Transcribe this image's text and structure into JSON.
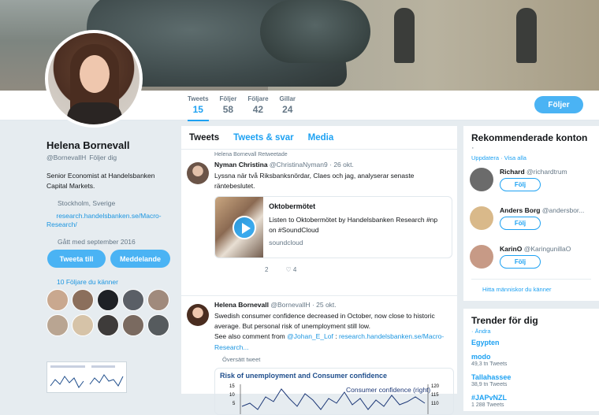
{
  "profile": {
    "name": "Helena Bornevall",
    "handle": "@BornevallH",
    "follows_you": "Följer dig",
    "bio": "Senior Economist at Handelsbanken Capital Markets.",
    "location": "Stockholm, Sverige",
    "url": "research.handelsbanken.se/Macro-Research/",
    "joined": "Gått med september 2016",
    "tweet_to": "Tweeta till",
    "message": "Meddelande",
    "followers_you_know": "10 Följare du känner"
  },
  "nav": {
    "stats": [
      {
        "label": "Tweets",
        "value": "15"
      },
      {
        "label": "Följer",
        "value": "58"
      },
      {
        "label": "Följare",
        "value": "42"
      },
      {
        "label": "Gillar",
        "value": "24"
      }
    ],
    "follow_button": "Följer"
  },
  "timeline": {
    "tabs": [
      "Tweets",
      "Tweets & svar",
      "Media"
    ],
    "tweets": [
      {
        "retweet_note": "Helena Bornevall Retweetade",
        "author": "Nyman Christina",
        "handle": "@ChristinaNyman9",
        "date": "· 26 okt.",
        "text": "Lyssna när två Riksbanksnördar, Claes och jag, analyserar senaste räntebeslutet.",
        "card": {
          "title": "Oktobermötet",
          "desc": "Listen to Oktobermötet by Handelsbanken Research #np on #SoundCloud",
          "domain": "soundcloud"
        },
        "replies": "",
        "retweets": "2",
        "likes": "4"
      },
      {
        "author": "Helena Bornevall",
        "handle": "@BornevallH",
        "date": "· 25 okt.",
        "text": "Swedish consumer confidence decreased in October, now close to historic average. But personal risk of unemployment still low.",
        "see_also": "See also comment from",
        "mention": "@Johan_E_Lof",
        "link": "research.handelsbanken.se/Macro-Research...",
        "translate": "Översätt tweet",
        "chart_title": "Risk of unemployment and Consumer confidence",
        "chart_legend": "Consumer confidence (right)",
        "chart_left_ticks": [
          "15",
          "10",
          "5"
        ],
        "chart_right_ticks": [
          "120",
          "115",
          "110"
        ]
      }
    ]
  },
  "recommended": {
    "title": "Rekommenderade konton",
    "dot": "·",
    "update": "Uppdatera · Visa alla",
    "follow_label": "Följ",
    "accounts": [
      {
        "name": "Richard",
        "handle": "@richardtrum",
        "color": "#6b6b6b"
      },
      {
        "name": "Anders Borg",
        "handle": "@andersbor...",
        "color": "#d9b98a"
      },
      {
        "name": "KarinO",
        "handle": "@KaringunillaO",
        "color": "#c79a86"
      }
    ],
    "find_people": "Hitta människor du känner"
  },
  "trends": {
    "title": "Trender för dig",
    "change": "· Ändra",
    "items": [
      {
        "name": "Egypten",
        "count": ""
      },
      {
        "name": "modo",
        "count": "49,3 tn Tweets"
      },
      {
        "name": "Tallahassee",
        "count": "38,9 tn Tweets"
      },
      {
        "name": "#JAPvNZL",
        "count": "1 288 Tweets"
      }
    ]
  },
  "colors": {
    "accent": "#1da1f2",
    "button": "#4ab3f4",
    "background": "#e6ecf0"
  }
}
